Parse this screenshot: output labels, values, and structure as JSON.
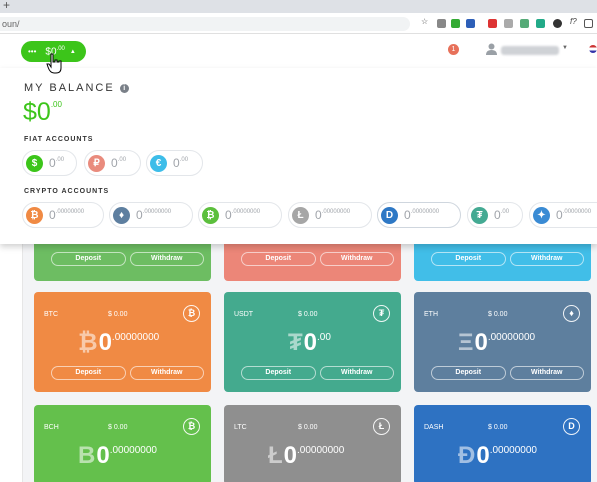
{
  "browser": {
    "url": "oun/"
  },
  "header": {
    "balance": "$0",
    "balance_decimals": ".00",
    "notifications_count": "1"
  },
  "panel": {
    "title": "MY BALANCE",
    "total": "$0",
    "total_decimals": ".00",
    "fiat_label": "FIAT ACCOUNTS",
    "crypto_label": "CRYPTO ACCOUNTS",
    "fiat": [
      {
        "symbol": "$",
        "value": "0",
        "decimals": ".00",
        "color": "#3cc51a"
      },
      {
        "symbol": "₽",
        "value": "0",
        "decimals": ".00",
        "color": "#e98b7d"
      },
      {
        "symbol": "€",
        "value": "0",
        "decimals": ".00",
        "color": "#3dbde9"
      }
    ],
    "crypto": [
      {
        "symbol": "₿",
        "value": "0",
        "decimals": ".00000000",
        "color": "#f08a44",
        "icon": "bitcoin-icon"
      },
      {
        "symbol": "♦",
        "value": "0",
        "decimals": ".00000000",
        "color": "#5e7fa0",
        "icon": "ethereum-icon"
      },
      {
        "symbol": "₿",
        "value": "0",
        "decimals": ".00000000",
        "color": "#5cbf3d",
        "icon": "bitcoin-cash-icon"
      },
      {
        "symbol": "Ł",
        "value": "0",
        "decimals": ".00000000",
        "color": "#a6a6a6",
        "icon": "litecoin-icon"
      },
      {
        "symbol": "D",
        "value": "0",
        "decimals": ".00000000",
        "color": "#2e78c5",
        "icon": "dash-icon"
      },
      {
        "symbol": "₮",
        "value": "0",
        "decimals": ".00",
        "color": "#44aa93",
        "icon": "tether-icon"
      },
      {
        "symbol": "✦",
        "value": "0",
        "decimals": ".00000000",
        "color": "#3a8bd4",
        "icon": "ripple-icon"
      }
    ]
  },
  "cards_row0": [
    {
      "deposit": "Deposit",
      "withdraw": "Withdraw",
      "color": "#6dbd62"
    },
    {
      "deposit": "Deposit",
      "withdraw": "Withdraw",
      "color": "#ec8678"
    },
    {
      "deposit": "Deposit",
      "withdraw": "Withdraw",
      "color": "#41bee8"
    }
  ],
  "cards": [
    {
      "name": "BTC",
      "usd": "$ 0.00",
      "symbol": "₿",
      "value": "0",
      "decimals": ".00000000",
      "icon": "₿",
      "icon_name": "bitcoin-icon",
      "color": "#f08a44",
      "deposit": "Deposit",
      "withdraw": "Withdraw"
    },
    {
      "name": "USDT",
      "usd": "$ 0.00",
      "symbol": "₮",
      "value": "0",
      "decimals": ".00",
      "icon": "₮",
      "icon_name": "tether-icon",
      "color": "#44aa8e",
      "deposit": "Deposit",
      "withdraw": "Withdraw"
    },
    {
      "name": "ETH",
      "usd": "$ 0.00",
      "symbol": "Ξ",
      "value": "0",
      "decimals": ".00000000",
      "icon": "♦",
      "icon_name": "ethereum-icon",
      "color": "#5e7f9e",
      "deposit": "Deposit",
      "withdraw": "Withdraw"
    },
    {
      "name": "BCH",
      "usd": "$ 0.00",
      "symbol": "B",
      "value": "0",
      "decimals": ".00000000",
      "icon": "₿",
      "icon_name": "bitcoin-cash-icon",
      "color": "#64c04c",
      "deposit": "",
      "withdraw": ""
    },
    {
      "name": "LTC",
      "usd": "$ 0.00",
      "symbol": "Ł",
      "value": "0",
      "decimals": ".00000000",
      "icon": "Ł",
      "icon_name": "litecoin-icon",
      "color": "#8f8f8f",
      "deposit": "",
      "withdraw": ""
    },
    {
      "name": "DASH",
      "usd": "$ 0.00",
      "symbol": "Đ",
      "value": "0",
      "decimals": ".00000000",
      "icon": "D",
      "icon_name": "dash-icon",
      "color": "#2e72c2",
      "deposit": "",
      "withdraw": ""
    }
  ]
}
